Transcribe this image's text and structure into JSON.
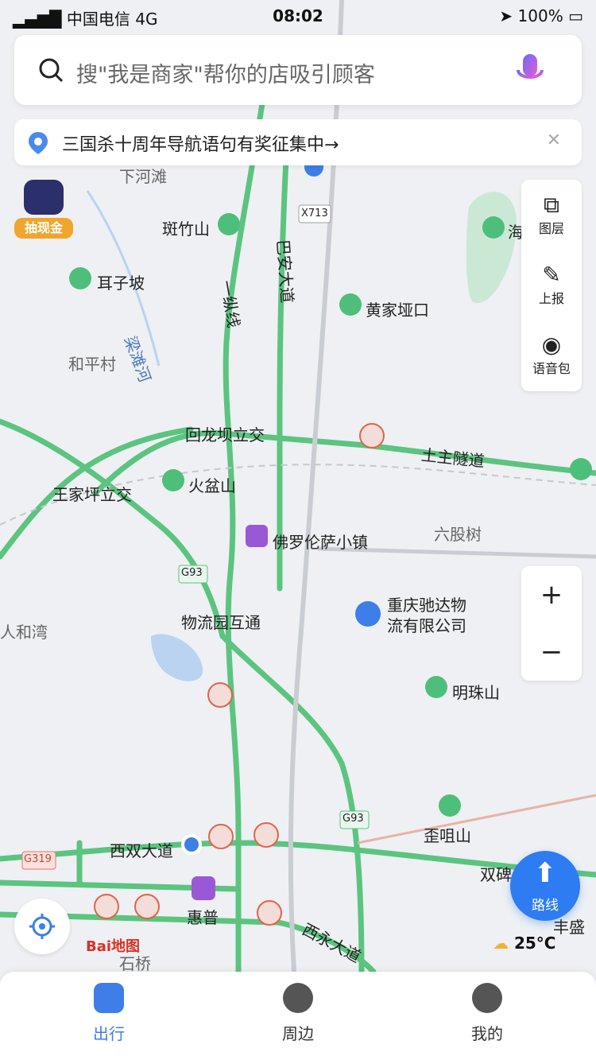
{
  "status_bar": {
    "carrier": "中国电信",
    "network": "4G",
    "time": "08:02",
    "battery": "100%"
  },
  "search": {
    "placeholder": "搜\"我是商家\"帮你的店吸引顾客"
  },
  "notice": {
    "text": "三国杀十周年导航语句有奖征集中→"
  },
  "promo": {
    "label": "抽现金"
  },
  "side_panel": {
    "items": [
      {
        "label": "图层",
        "icon": "layers-icon"
      },
      {
        "label": "上报",
        "icon": "report-icon"
      },
      {
        "label": "语音包",
        "icon": "voice-pack-icon"
      }
    ]
  },
  "zoom": {
    "in": "+",
    "out": "−"
  },
  "route_button": {
    "label": "路线"
  },
  "weather": {
    "temperature": "25°C"
  },
  "baidu_logo": "Bai地图",
  "tabs": [
    {
      "label": "出行",
      "active": true
    },
    {
      "label": "周边",
      "active": false
    },
    {
      "label": "我的",
      "active": false
    }
  ],
  "map_labels": {
    "xiaheitan": "下河滩",
    "banzhushan": "斑竹山",
    "erzipo": "耳子坡",
    "x713": "X713",
    "lianshanhe": "梁滩河",
    "hepingcun": "和平村",
    "yizongxian": "一纵线",
    "bianandadao": "巴安大道",
    "huangjiayakou": "黄家垭口",
    "huilongbalijiao": "回龙坝立交",
    "tuzhusuidao": "土主隧道",
    "wangjiapinglijiao": "王家坪立交",
    "huopenshan": "火盆山",
    "liugushu": "六股树",
    "foluolunsa": "佛罗伦萨小镇",
    "g93_a": "G93",
    "wuliuyuanhutong": "物流园互通",
    "renhewan": "人和湾",
    "chongqingchida": "重庆驰达物流有限公司",
    "mingzhushan": "明珠山",
    "g93_b": "G93",
    "waijushan": "歪咀山",
    "xishuangdadao": "西双大道",
    "g319": "G319",
    "shuangbi": "双碑",
    "huipu": "惠普",
    "xiyongdadao": "西永大道",
    "shiqiao": "石桥",
    "fengsheng": "丰盛",
    "haifeng": "海"
  }
}
